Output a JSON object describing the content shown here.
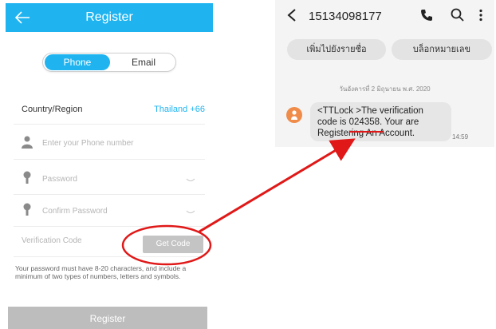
{
  "register": {
    "title": "Register",
    "tabs": [
      "Phone",
      "Email"
    ],
    "country_label": "Country/Region",
    "country_value": "Thailand +66",
    "phone_placeholder": "Enter your Phone number",
    "password_placeholder": "Password",
    "confirm_placeholder": "Confirm Password",
    "verification_placeholder": "Verification Code",
    "get_code_label": "Get Code",
    "hint": "Your password must have 8-20 characters, and include a minimum of two types of numbers, letters and symbols.",
    "register_label": "Register",
    "accent_color": "#1fb4f0"
  },
  "sms": {
    "number": "15134098177",
    "add_contact_label": "เพิ่มไปยังรายชื่อ",
    "block_label": "บล็อกหมายเลข",
    "date": "วันอังคารที่ 2 มิถุนายน พ.ศ. 2020",
    "message_prefix": "<TTLock >The verification code is ",
    "code": "024358",
    "message_suffix": ". Your are Registering An Account.",
    "time": "14:59"
  },
  "annotation": {
    "color": "#e01818"
  },
  "icons": [
    "back-arrow-icon",
    "person-icon",
    "key-icon",
    "eye-icon",
    "phone-icon",
    "search-icon",
    "more-vertical-icon",
    "avatar-icon"
  ]
}
